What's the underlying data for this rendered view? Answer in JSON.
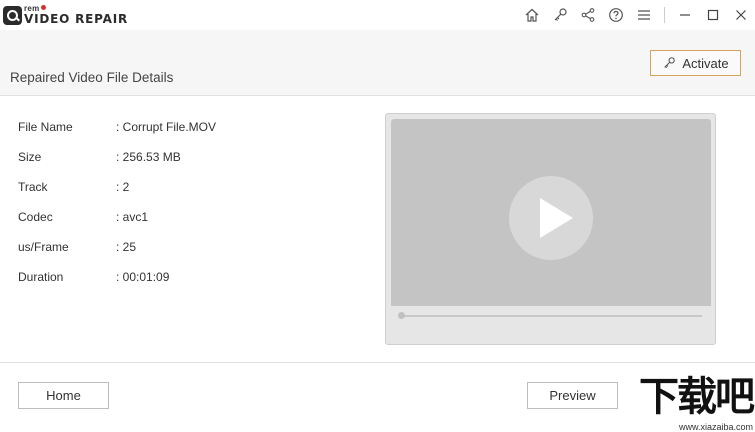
{
  "app": {
    "logo_brand": "rem",
    "logo_product": "VIDEO REPAIR"
  },
  "titlebar": {
    "icons": [
      "home-icon",
      "key-icon",
      "share-icon",
      "help-icon",
      "menu-icon",
      "minimize-icon",
      "maximize-icon",
      "close-icon"
    ]
  },
  "header": {
    "title": "Repaired Video File Details",
    "activate_label": "Activate"
  },
  "details": [
    {
      "label": "File Name",
      "value": ": Corrupt File.MOV"
    },
    {
      "label": "Size",
      "value": ": 256.53 MB"
    },
    {
      "label": "Track",
      "value": ": 2"
    },
    {
      "label": "Codec",
      "value": ": avc1"
    },
    {
      "label": "us/Frame",
      "value": ": 25"
    },
    {
      "label": "Duration",
      "value": ": 00:01:09"
    }
  ],
  "player": {
    "progress": 0
  },
  "footer": {
    "home_label": "Home",
    "preview_label": "Preview"
  },
  "watermark": {
    "text": "下载吧",
    "url": "www.xiazaiba.com"
  }
}
